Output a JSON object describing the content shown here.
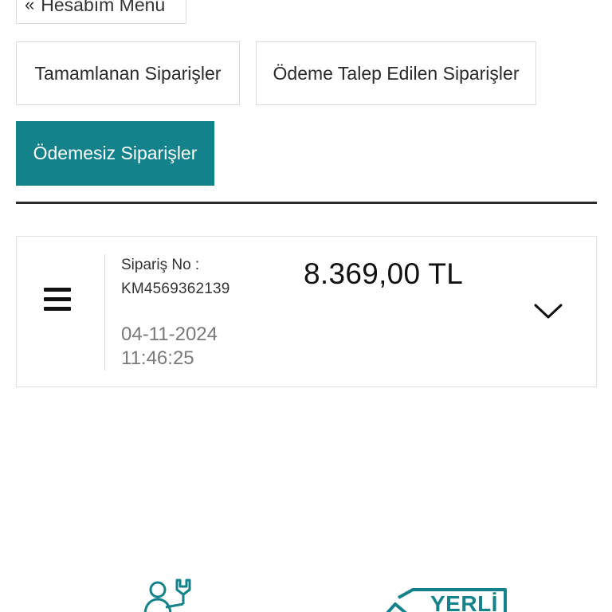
{
  "back_button": {
    "icon": "double-chevron-left-icon",
    "label": "Hesabım Menü"
  },
  "tabs": [
    {
      "label": "Tamamlanan Siparişler",
      "active": false
    },
    {
      "label": "Ödeme Talep Edilen Siparişler",
      "active": false
    },
    {
      "label": "Ödemesiz Siparişler",
      "active": true
    }
  ],
  "accent_color": "#13828b",
  "order": {
    "number_label": "Sipariş No :",
    "number": "KM4569362139",
    "amount": "8.369,00 TL",
    "date": "04-11-2024",
    "time": "11:46:25",
    "menu_icon": "hamburger-menu-icon",
    "expand_icon": "chevron-down-icon"
  },
  "footer": {
    "service_icon": "support-service-icon",
    "badge_text": "YERLİ"
  }
}
